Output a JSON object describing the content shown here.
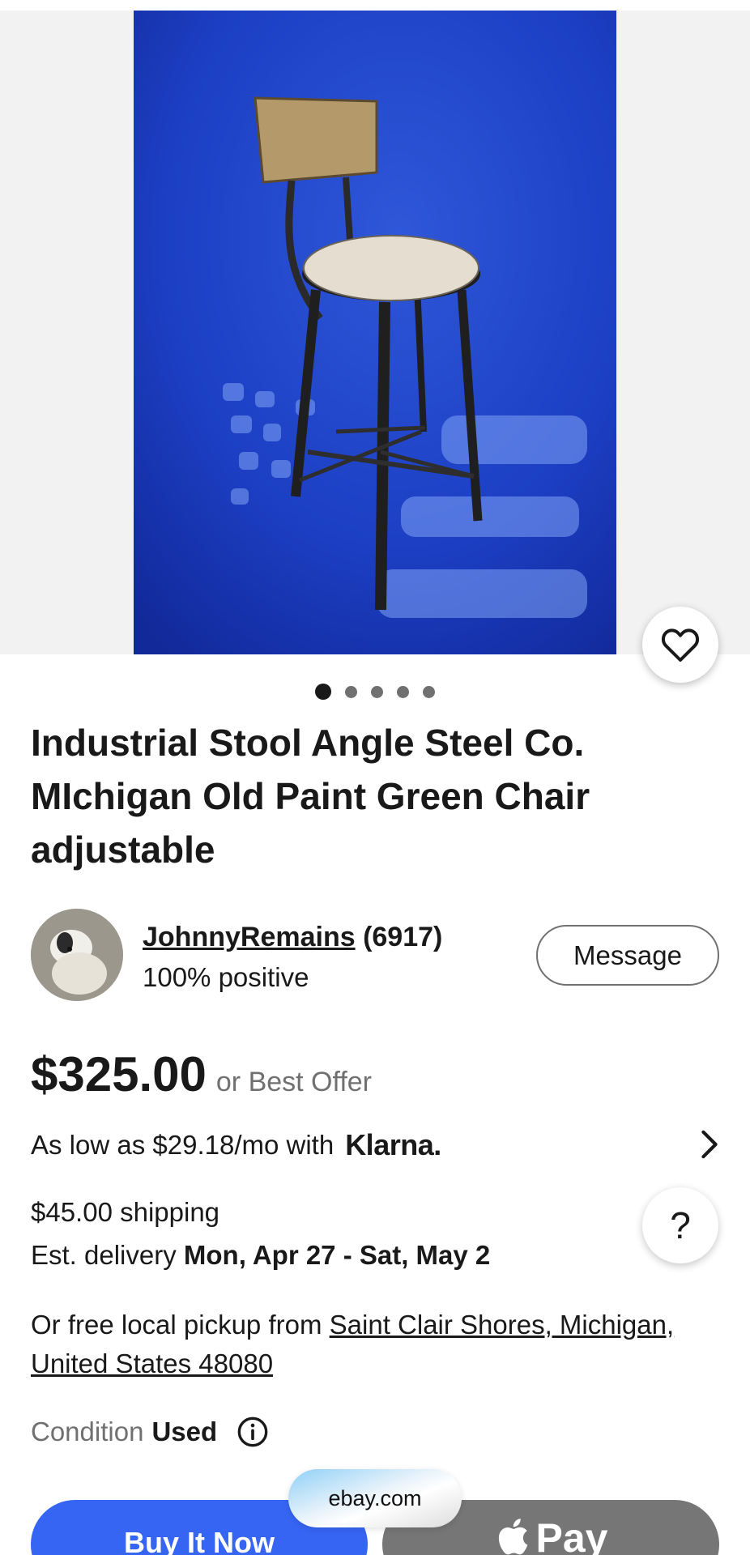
{
  "listing": {
    "title": "Industrial Stool Angle Steel Co. MIchigan Old Paint Green Chair adjustable",
    "image_count": 5,
    "active_image_index": 0
  },
  "seller": {
    "name": "JohnnyRemains",
    "feedback_count": "(6917)",
    "positive": "100% positive",
    "message_label": "Message"
  },
  "pricing": {
    "price": "$325.00",
    "best_offer": "or Best Offer",
    "klarna_text": "As low as $29.18/mo with",
    "klarna_brand": "Klarna."
  },
  "shipping": {
    "cost": "$45.00 shipping",
    "delivery_label": "Est. delivery",
    "delivery_dates": "Mon, Apr 27 - Sat, May 2",
    "pickup_prefix": "Or free local pickup from",
    "pickup_location": "Saint Clair Shores, Michigan, United States 48080"
  },
  "condition": {
    "label": "Condition",
    "value": "Used"
  },
  "actions": {
    "buy_now": "Buy It Now",
    "apple_pay": "Pay",
    "help": "?"
  },
  "browser": {
    "url": "ebay.com"
  },
  "colors": {
    "primary_blue": "#3665f3",
    "text": "#191919",
    "muted": "#707070",
    "backdrop_blue": "#1c3fc4"
  },
  "icons": {
    "favorite": "heart-icon",
    "klarna_more": "chevron-right-icon",
    "condition_info": "info-icon",
    "apple": "apple-logo-icon"
  }
}
